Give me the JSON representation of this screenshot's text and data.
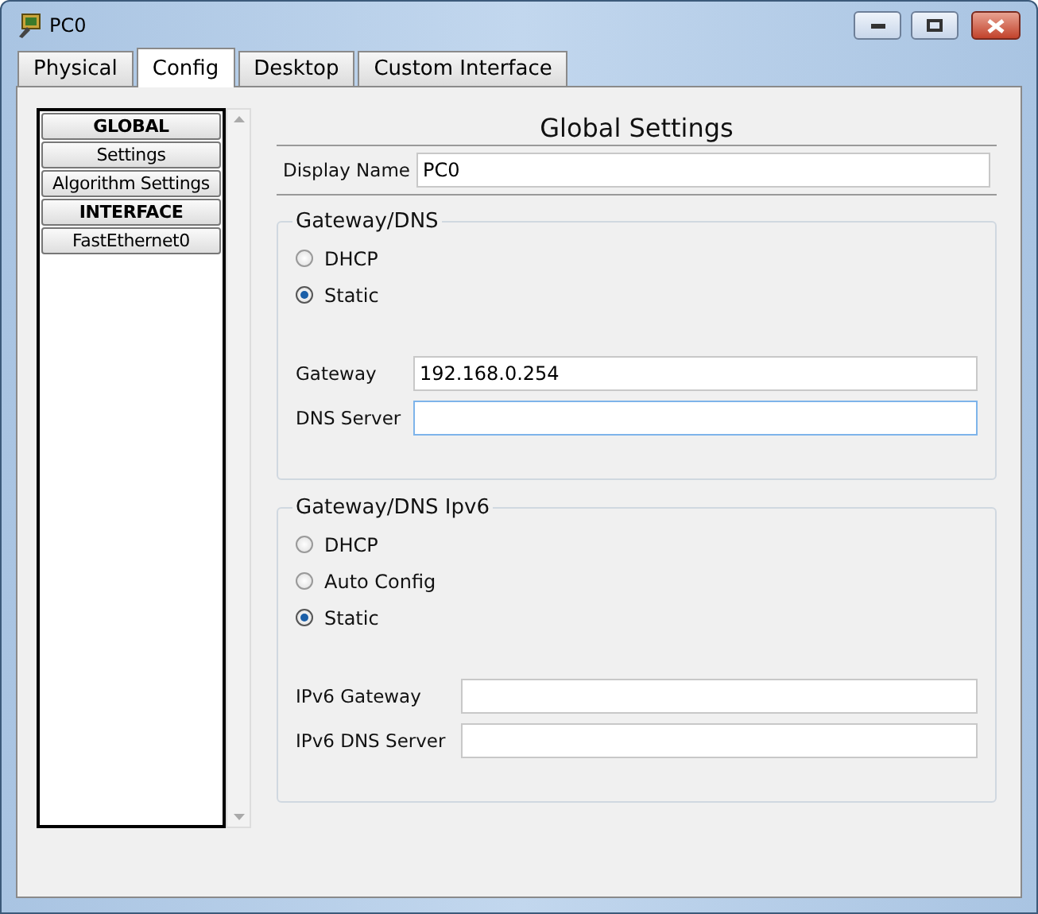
{
  "window": {
    "title": "PC0"
  },
  "tabs": [
    {
      "label": "Physical",
      "selected": false
    },
    {
      "label": "Config",
      "selected": true
    },
    {
      "label": "Desktop",
      "selected": false
    },
    {
      "label": "Custom Interface",
      "selected": false
    }
  ],
  "sidebar": {
    "items": [
      {
        "label": "GLOBAL",
        "kind": "header"
      },
      {
        "label": "Settings",
        "kind": "item"
      },
      {
        "label": "Algorithm Settings",
        "kind": "item"
      },
      {
        "label": "INTERFACE",
        "kind": "header"
      },
      {
        "label": "FastEthernet0",
        "kind": "item"
      }
    ]
  },
  "settings": {
    "title": "Global Settings",
    "display_name": {
      "label": "Display Name",
      "value": "PC0"
    },
    "groups": [
      {
        "title": "Gateway/DNS",
        "options": [
          {
            "label": "DHCP",
            "selected": false
          },
          {
            "label": "Static",
            "selected": true
          }
        ],
        "fields": [
          {
            "label": "Gateway",
            "value": "192.168.0.254",
            "focused": false
          },
          {
            "label": "DNS Server",
            "focused": true
          }
        ]
      },
      {
        "title": "Gateway/DNS Ipv6",
        "options": [
          {
            "label": "DHCP",
            "selected": false
          },
          {
            "label": "Auto Config",
            "selected": false
          },
          {
            "label": "Static",
            "selected": true
          }
        ],
        "fields": [
          {
            "label": "IPv6 Gateway",
            "focused": false
          },
          {
            "label": "IPv6 DNS Server",
            "focused": false
          }
        ]
      }
    ]
  }
}
